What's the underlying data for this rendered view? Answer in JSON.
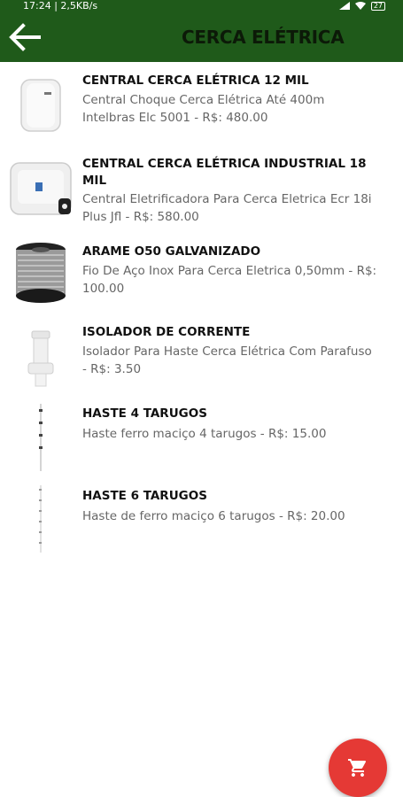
{
  "status_bar": {
    "time_speed": "17:24 | 2,5KB/s",
    "battery": "27"
  },
  "app_bar": {
    "title": "CERCA ELÉTRICA",
    "back_icon": "arrow-left-icon"
  },
  "products": [
    {
      "title": "CENTRAL CERCA ELÉTRICA 12 MIL",
      "desc_line1": "Central Choque Cerca Elétrica Até 400m",
      "desc_line2": "Intelbras Elc 5001 - R$: 480.00",
      "image": "electric-fence-central-icon"
    },
    {
      "title_line1": "CENTRAL CERCA ELÉTRICA INDUSTRIAL  18",
      "title_line2": "MIL",
      "desc_line1": "Central Eletrificadora Para Cerca Eletrica Ecr 18i",
      "desc_line2": "Plus Jfl  - R$: 580.00",
      "image": "industrial-central-icon"
    },
    {
      "title": "ARAME O50 GALVANIZADO",
      "desc_line1": "Fio De Aço Inox Para Cerca Eletrica 0,50mm - R$:",
      "desc_line2": "100.00",
      "image": "wire-spool-icon"
    },
    {
      "title": "ISOLADOR DE CORRENTE",
      "desc_line1": "Isolador Para Haste Cerca Elétrica Com Parafuso",
      "desc_line2": "- R$: 3.50",
      "image": "insulator-icon"
    },
    {
      "title": "HASTE 4 TARUGOS",
      "desc_line1": "Haste ferro  maciço 4 tarugos - R$: 15.00",
      "image": "rod-4-icon"
    },
    {
      "title": "HASTE 6 TARUGOS",
      "desc_line1": "Haste de ferro maciço 6 tarugos  - R$: 20.00",
      "image": "rod-6-icon"
    }
  ],
  "fab": {
    "icon": "cart-icon",
    "color": "#e53935"
  },
  "colors": {
    "app_bar": "#1f5a1a",
    "title": "#0c1a08"
  }
}
